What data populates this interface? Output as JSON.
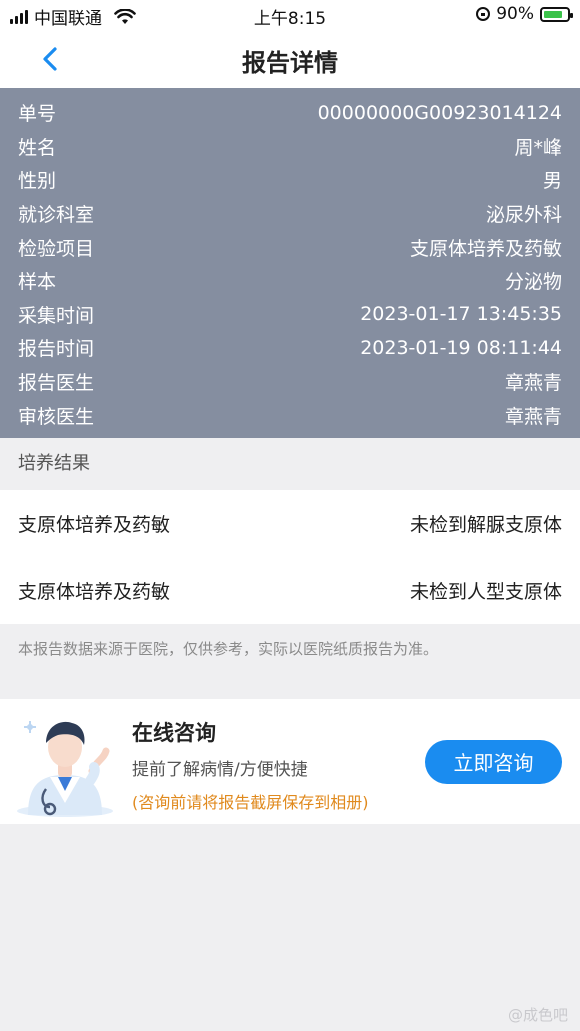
{
  "status_bar": {
    "carrier": "中国联通",
    "time": "上午8:15",
    "battery": "90%"
  },
  "nav": {
    "title": "报告详情"
  },
  "info": [
    {
      "label": "单号",
      "value": "00000000G00923014124"
    },
    {
      "label": "姓名",
      "value": "周*峰"
    },
    {
      "label": "性别",
      "value": "男"
    },
    {
      "label": "就诊科室",
      "value": "泌尿外科"
    },
    {
      "label": "检验项目",
      "value": "支原体培养及药敏"
    },
    {
      "label": "样本",
      "value": "分泌物"
    },
    {
      "label": "采集时间",
      "value": "2023-01-17 13:45:35"
    },
    {
      "label": "报告时间",
      "value": "2023-01-19 08:11:44"
    },
    {
      "label": "报告医生",
      "value": "章燕青"
    },
    {
      "label": "审核医生",
      "value": "章燕青"
    }
  ],
  "results": {
    "section_title": "培养结果",
    "rows": [
      {
        "name": "支原体培养及药敏",
        "result": "未检到解脲支原体"
      },
      {
        "name": "支原体培养及药敏",
        "result": "未检到人型支原体"
      }
    ]
  },
  "disclaimer": "本报告数据来源于医院，仅供参考，实际以医院纸质报告为准。",
  "consult": {
    "title": "在线咨询",
    "subtitle": "提前了解病情/方便快捷",
    "note": "(咨询前请将报告截屏保存到相册)",
    "button": "立即咨询"
  },
  "watermark": "@成色吧",
  "colors": {
    "info_bg": "#858ea0",
    "accent": "#1a8cf0",
    "note": "#e08a1e"
  }
}
